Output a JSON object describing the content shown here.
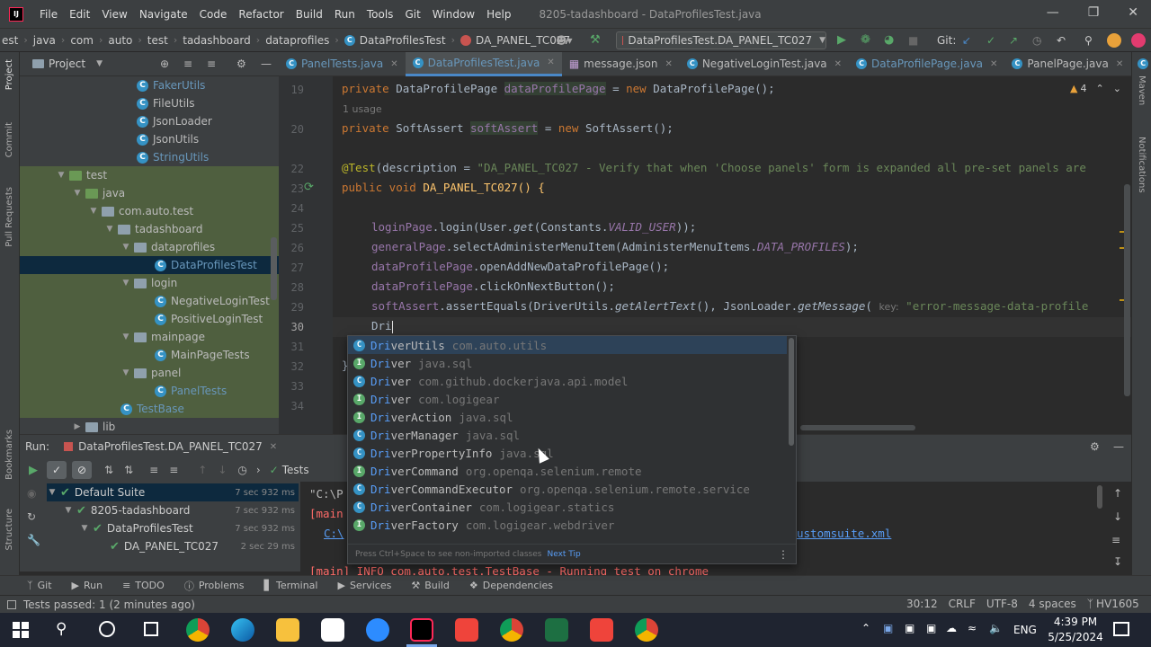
{
  "window": {
    "title": "8205-tadashboard - DataProfilesTest.java",
    "menu": [
      "File",
      "Edit",
      "View",
      "Navigate",
      "Code",
      "Refactor",
      "Build",
      "Run",
      "Tools",
      "Git",
      "Window",
      "Help"
    ]
  },
  "breadcrumb": [
    "est",
    "java",
    "com",
    "auto",
    "test",
    "tadashboard",
    "dataprofiles",
    "DataProfilesTest",
    "DA_PANEL_TC027"
  ],
  "run_config": "DataProfilesTest.DA_PANEL_TC027",
  "git_label": "Git:",
  "project": {
    "header": "Project",
    "tree": [
      {
        "label": "FakerUtils",
        "kind": "class"
      },
      {
        "label": "FileUtils",
        "kind": "class"
      },
      {
        "label": "JsonLoader",
        "kind": "class"
      },
      {
        "label": "JsonUtils",
        "kind": "class"
      },
      {
        "label": "StringUtils",
        "kind": "class"
      },
      {
        "label": "test",
        "kind": "folder"
      },
      {
        "label": "java",
        "kind": "folder"
      },
      {
        "label": "com.auto.test",
        "kind": "folder"
      },
      {
        "label": "tadashboard",
        "kind": "folder"
      },
      {
        "label": "dataprofiles",
        "kind": "folder"
      },
      {
        "label": "DataProfilesTest",
        "kind": "class"
      },
      {
        "label": "login",
        "kind": "folder"
      },
      {
        "label": "NegativeLoginTest",
        "kind": "class"
      },
      {
        "label": "PositiveLoginTest",
        "kind": "class"
      },
      {
        "label": "mainpage",
        "kind": "folder"
      },
      {
        "label": "MainPageTests",
        "kind": "class"
      },
      {
        "label": "panel",
        "kind": "folder"
      },
      {
        "label": "PanelTests",
        "kind": "class"
      },
      {
        "label": "TestBase",
        "kind": "class"
      },
      {
        "label": "lib",
        "kind": "folder"
      }
    ]
  },
  "tabs": [
    "PanelTests.java",
    "DataProfilesTest.java",
    "message.json",
    "NegativeLoginTest.java",
    "DataProfilePage.java",
    "PanelPage.java"
  ],
  "editor": {
    "line_numbers": [
      "19",
      "",
      "20",
      "",
      "22",
      "23",
      "24",
      "25",
      "26",
      "27",
      "28",
      "29",
      "30",
      "31",
      "32",
      "33",
      "34"
    ],
    "usage_hint": "1 usage",
    "warning_count": "4",
    "lines": {
      "l19_kw": "private",
      "l19_type": "DataProfilePage",
      "l19_field": "dataProfilePage",
      "l19_eq": "=",
      "l19_new": "new",
      "l19_call": "DataProfilePage();",
      "l20_kw": "private",
      "l20_type": "SoftAssert",
      "l20_field": "softAssert",
      "l20_eq": "=",
      "l20_new": "new",
      "l20_call": "SoftAssert();",
      "l22_ann": "@Test",
      "l22_rest": "(description = ",
      "l22_str": "\"DA_PANEL_TC027 - Verify that when 'Choose panels' form is expanded all pre-set panels are",
      "l23_kw": "public void",
      "l23_name": "DA_PANEL_TC027() {",
      "l25_field": "loginPage",
      "l25_rest1": ".login(User.",
      "l25_meth": "get",
      "l25_rest2": "(Constants.",
      "l25_static": "VALID_USER",
      "l25_rest3": "));",
      "l26_field": "generalPage",
      "l26_rest1": ".selectAdministerMenuItem(AdministerMenuItems.",
      "l26_static": "DATA_PROFILES",
      "l26_rest2": ");",
      "l27_field": "dataProfilePage",
      "l27_rest": ".openAddNewDataProfilePage();",
      "l28_field": "dataProfilePage",
      "l28_rest": ".clickOnNextButton();",
      "l29_field": "softAssert",
      "l29_rest1": ".assertEquals(DriverUtils.",
      "l29_meth": "getAlertText",
      "l29_rest2": "(), JsonLoader.",
      "l29_meth2": "getMessage",
      "l29_rest3": "(",
      "l29_hint": "key:",
      "l29_str": "\"error-message-data-profile",
      "l30_typed": "Dri",
      "l32_brace": "}"
    }
  },
  "completion": {
    "items": [
      {
        "match": "Dri",
        "rest": "verUtils",
        "pkg": "com.auto.utils",
        "kind": "class"
      },
      {
        "match": "Dri",
        "rest": "ver",
        "pkg": "java.sql",
        "kind": "interface"
      },
      {
        "match": "Dri",
        "rest": "ver",
        "pkg": "com.github.dockerjava.api.model",
        "kind": "class"
      },
      {
        "match": "Dri",
        "rest": "ver",
        "pkg": "com.logigear",
        "kind": "interface"
      },
      {
        "match": "Dri",
        "rest": "verAction",
        "pkg": "java.sql",
        "kind": "interface"
      },
      {
        "match": "Dri",
        "rest": "verManager",
        "pkg": "java.sql",
        "kind": "class"
      },
      {
        "match": "Dri",
        "rest": "verPropertyInfo",
        "pkg": "java.sql",
        "kind": "class"
      },
      {
        "match": "Dri",
        "rest": "verCommand",
        "pkg": "org.openqa.selenium.remote",
        "kind": "interface"
      },
      {
        "match": "Dri",
        "rest": "verCommandExecutor",
        "pkg": "org.openqa.selenium.remote.service",
        "kind": "class"
      },
      {
        "match": "Dri",
        "rest": "verContainer",
        "pkg": "com.logigear.statics",
        "kind": "class"
      },
      {
        "match": "Dri",
        "rest": "verFactory",
        "pkg": "com.logigear.webdriver",
        "kind": "interface"
      }
    ],
    "footer": "Press Ctrl+Space to see non-imported classes",
    "footer_link": "Next Tip"
  },
  "run": {
    "label": "Run:",
    "config": "DataProfilesTest.DA_PANEL_TC027",
    "tests_label": "Tests",
    "tree": [
      {
        "label": "Default Suite",
        "time": "7 sec 932 ms"
      },
      {
        "label": "8205-tadashboard",
        "time": "7 sec 932 ms"
      },
      {
        "label": "DataProfilesTest",
        "time": "7 sec 932 ms"
      },
      {
        "label": "DA_PANEL_TC027",
        "time": "2 sec 29 ms"
      }
    ],
    "console": {
      "line1": "\"C:\\P",
      "line2": "[main",
      "line3": "C:\\",
      "line3_right": "ustomsuite.xml",
      "line4": "[main] INFO com.auto.test.TestBase - Running test on chrome"
    }
  },
  "tool_tabs": [
    "Git",
    "Run",
    "TODO",
    "Problems",
    "Terminal",
    "Services",
    "Build",
    "Dependencies"
  ],
  "status": {
    "message": "Tests passed: 1 (2 minutes ago)",
    "position": "30:12",
    "line_sep": "CRLF",
    "encoding": "UTF-8",
    "indent": "4 spaces",
    "heap": "HV1605"
  },
  "taskbar": {
    "lang": "ENG",
    "time": "4:39 PM",
    "date": "5/25/2024"
  },
  "side_labels": {
    "left": [
      "Project",
      "Commit",
      "Pull Requests",
      "Bookmarks",
      "Structure"
    ],
    "right": [
      "Maven",
      "Notifications"
    ]
  }
}
